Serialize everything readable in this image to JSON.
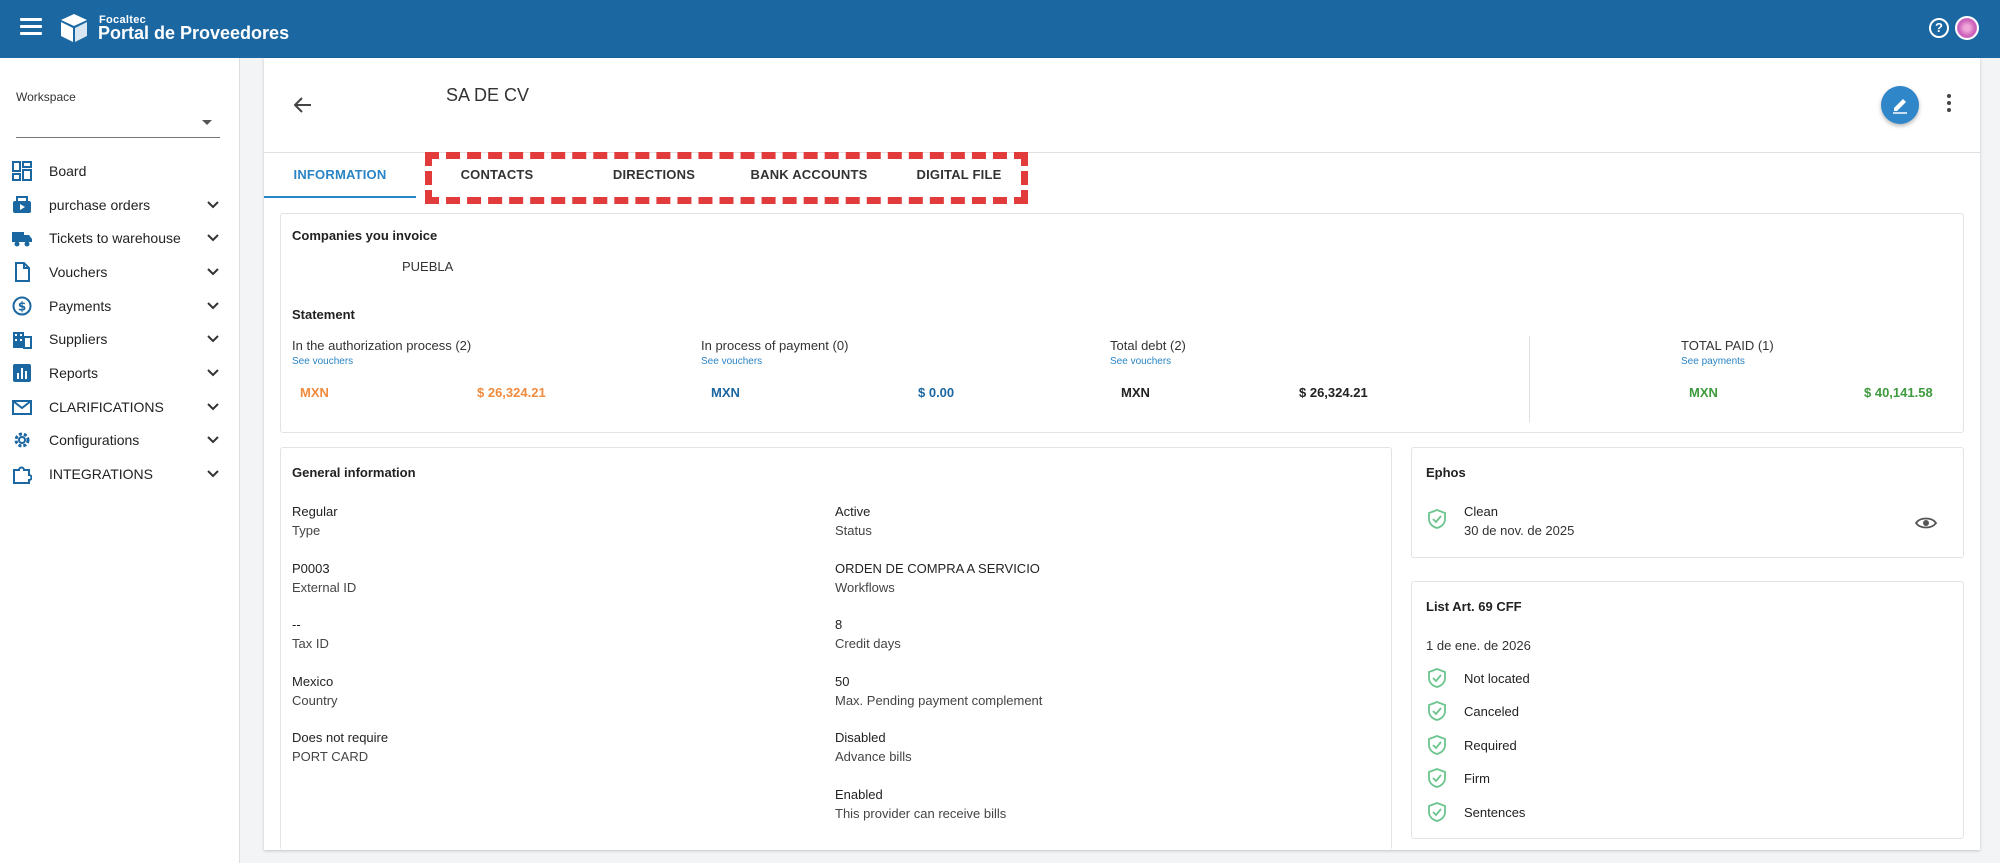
{
  "app": {
    "brand_small": "Focaltec",
    "brand_big": "Portal de Proveedores"
  },
  "sidebar": {
    "workspace_label": "Workspace",
    "workspace_value": "",
    "items": [
      {
        "label": "Board",
        "icon": "dashboard-icon",
        "expandable": false
      },
      {
        "label": "purchase orders",
        "icon": "orders-icon",
        "expandable": true
      },
      {
        "label": "Tickets to warehouse",
        "icon": "truck-icon",
        "expandable": true
      },
      {
        "label": "Vouchers",
        "icon": "document-icon",
        "expandable": true
      },
      {
        "label": "Payments",
        "icon": "dollar-icon",
        "expandable": true
      },
      {
        "label": "Suppliers",
        "icon": "building-icon",
        "expandable": true
      },
      {
        "label": "Reports",
        "icon": "chart-icon",
        "expandable": true
      },
      {
        "label": "CLARIFICATIONS",
        "icon": "mail-icon",
        "expandable": true
      },
      {
        "label": "Configurations",
        "icon": "gear-icon",
        "expandable": true
      },
      {
        "label": "INTEGRATIONS",
        "icon": "puzzle-icon",
        "expandable": true
      }
    ]
  },
  "header": {
    "title": "SA DE CV"
  },
  "tabs": [
    "INFORMATION",
    "CONTACTS",
    "DIRECTIONS",
    "BANK ACCOUNTS",
    "DIGITAL FILE"
  ],
  "companies": {
    "title": "Companies you invoice",
    "value": "PUEBLA"
  },
  "statement": {
    "title": "Statement",
    "blocks": [
      {
        "label": "In the authorization process (2)",
        "link": "See vouchers",
        "currency": "MXN",
        "amount": "$ 26,324.21",
        "color": "#f08a3c"
      },
      {
        "label": "In process of payment (0)",
        "link": "See vouchers",
        "currency": "MXN",
        "amount": "$ 0.00",
        "color": "#1b67a1"
      },
      {
        "label": "Total debt (2)",
        "link": "See vouchers",
        "currency": "MXN",
        "amount": "$ 26,324.21",
        "color": "#222222"
      },
      {
        "label": "TOTAL PAID (1)",
        "link": "See payments",
        "currency": "MXN",
        "amount": "$ 40,141.58",
        "color": "#3d9a3d"
      }
    ]
  },
  "general": {
    "title": "General information",
    "left": [
      {
        "value": "Regular",
        "label": "Type"
      },
      {
        "value": "P0003",
        "label": "External ID"
      },
      {
        "value": "--",
        "label": "Tax ID"
      },
      {
        "value": "Mexico",
        "label": "Country"
      },
      {
        "value": "Does not require",
        "label": "PORT CARD"
      }
    ],
    "right": [
      {
        "value": "Active",
        "label": "Status"
      },
      {
        "value": "ORDEN DE COMPRA A SERVICIO",
        "label": "Workflows"
      },
      {
        "value": "8",
        "label": "Credit days"
      },
      {
        "value": "50",
        "label": "Max. Pending payment complement"
      },
      {
        "value": "Disabled",
        "label": "Advance bills"
      },
      {
        "value": "Enabled",
        "label": "This provider can receive bills"
      }
    ]
  },
  "ephos": {
    "title": "Ephos",
    "status": "Clean",
    "date": "30 de nov. de 2025"
  },
  "art69": {
    "title": "List Art. 69 CFF",
    "date": "1 de ene. de 2026",
    "items": [
      "Not located",
      "Canceled",
      "Required",
      "Firm",
      "Sentences"
    ]
  },
  "colors": {
    "topbar": "#1b67a1",
    "accent": "#2a84c5",
    "highlight": "#e23b3b",
    "shield": "#6cc58e"
  }
}
